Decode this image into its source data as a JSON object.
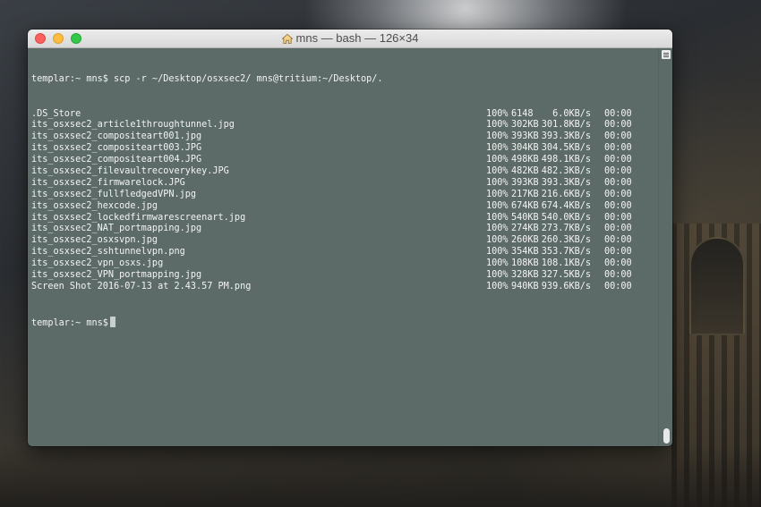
{
  "window": {
    "title": "mns — bash — 126×34",
    "title_icon": "home-icon"
  },
  "terminal": {
    "command_prompt": "templar:~ mns$",
    "command": "scp -r ~/Desktop/osxsec2/ mns@tritium:~/Desktop/.",
    "transfers": [
      {
        "file": ".DS_Store",
        "pct": "100%",
        "size": "6148",
        "rate": "6.0KB/s",
        "time": "00:00"
      },
      {
        "file": "its_osxsec2_article1throughtunnel.jpg",
        "pct": "100%",
        "size": "302KB",
        "rate": "301.8KB/s",
        "time": "00:00"
      },
      {
        "file": "its_osxsec2_compositeart001.jpg",
        "pct": "100%",
        "size": "393KB",
        "rate": "393.3KB/s",
        "time": "00:00"
      },
      {
        "file": "its_osxsec2_compositeart003.JPG",
        "pct": "100%",
        "size": "304KB",
        "rate": "304.5KB/s",
        "time": "00:00"
      },
      {
        "file": "its_osxsec2_compositeart004.JPG",
        "pct": "100%",
        "size": "498KB",
        "rate": "498.1KB/s",
        "time": "00:00"
      },
      {
        "file": "its_osxsec2_filevaultrecoverykey.JPG",
        "pct": "100%",
        "size": "482KB",
        "rate": "482.3KB/s",
        "time": "00:00"
      },
      {
        "file": "its_osxsec2_firmwarelock.JPG",
        "pct": "100%",
        "size": "393KB",
        "rate": "393.3KB/s",
        "time": "00:00"
      },
      {
        "file": "its_osxsec2_fullfledgedVPN.jpg",
        "pct": "100%",
        "size": "217KB",
        "rate": "216.6KB/s",
        "time": "00:00"
      },
      {
        "file": "its_osxsec2_hexcode.jpg",
        "pct": "100%",
        "size": "674KB",
        "rate": "674.4KB/s",
        "time": "00:00"
      },
      {
        "file": "its_osxsec2_lockedfirmwarescreenart.jpg",
        "pct": "100%",
        "size": "540KB",
        "rate": "540.0KB/s",
        "time": "00:00"
      },
      {
        "file": "its_osxsec2_NAT_portmapping.jpg",
        "pct": "100%",
        "size": "274KB",
        "rate": "273.7KB/s",
        "time": "00:00"
      },
      {
        "file": "its_osxsec2_osxsvpn.jpg",
        "pct": "100%",
        "size": "260KB",
        "rate": "260.3KB/s",
        "time": "00:00"
      },
      {
        "file": "its_osxsec2_sshtunnelvpn.png",
        "pct": "100%",
        "size": "354KB",
        "rate": "353.7KB/s",
        "time": "00:00"
      },
      {
        "file": "its_osxsec2_vpn_osxs.jpg",
        "pct": "100%",
        "size": "108KB",
        "rate": "108.1KB/s",
        "time": "00:00"
      },
      {
        "file": "its_osxsec2_VPN_portmapping.jpg",
        "pct": "100%",
        "size": "328KB",
        "rate": "327.5KB/s",
        "time": "00:00"
      },
      {
        "file": "Screen Shot 2016-07-13 at 2.43.57 PM.png",
        "pct": "100%",
        "size": "940KB",
        "rate": "939.6KB/s",
        "time": "00:00"
      }
    ],
    "final_prompt": "templar:~ mns$"
  },
  "colors": {
    "terminal_background": "#5d6b68",
    "terminal_text": "#f2f4f3",
    "close_button": "#fc605c",
    "minimize_button": "#fdbc40",
    "maximize_button": "#34c84a"
  }
}
